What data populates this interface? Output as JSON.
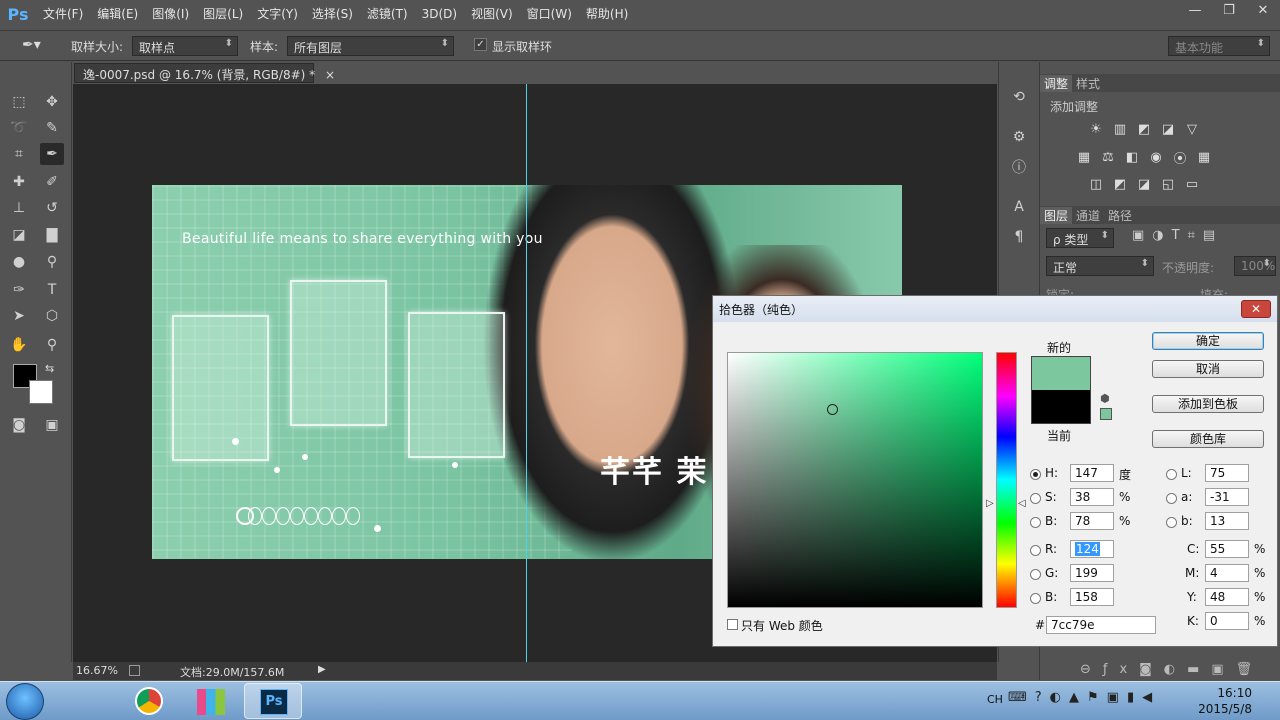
{
  "app": {
    "logo": "Ps"
  },
  "menu": [
    "文件(F)",
    "编辑(E)",
    "图像(I)",
    "图层(L)",
    "文字(Y)",
    "选择(S)",
    "滤镜(T)",
    "3D(D)",
    "视图(V)",
    "窗口(W)",
    "帮助(H)"
  ],
  "window_controls": [
    "—",
    "❐",
    "✕"
  ],
  "options": {
    "sample_size_label": "取样大小:",
    "sample_size_value": "取样点",
    "sample_label": "样本:",
    "sample_value": "所有图层",
    "show_ring_label": "显示取样环",
    "workspace": "基本功能"
  },
  "document": {
    "tab_title": "逸-0007.psd @ 16.7% (背景, RGB/8#) *",
    "tab_close": "×",
    "tagline": "Beautiful life means to share everything with you",
    "logo_text": "芊芊 茉",
    "zoom": "16.67%",
    "doc_size": "文档:29.0M/157.6M"
  },
  "panels": {
    "adjust_tabs": [
      "调整",
      "样式"
    ],
    "adjust_title": "添加调整",
    "layer_tabs": [
      "图层",
      "通道",
      "路径"
    ],
    "filter_label": "ρ 类型",
    "blend_mode": "正常",
    "opacity_label": "不透明度:",
    "opacity_value": "100%",
    "lock_label": "锁定:",
    "fill_label": "填充:"
  },
  "picker": {
    "title": "拾色器（纯色）",
    "close": "✕",
    "new_label": "新的",
    "current_label": "当前",
    "new_color": "#7cc79e",
    "current_color": "#000000",
    "buttons": {
      "ok": "确定",
      "cancel": "取消",
      "add_swatch": "添加到色板",
      "libraries": "颜色库"
    },
    "fields": {
      "H": "147",
      "S": "38",
      "B": "78",
      "R": "124",
      "G": "199",
      "Bv": "158",
      "L": "75",
      "a": "-31",
      "b": "13",
      "C": "55",
      "M": "4",
      "Y": "48",
      "K": "0"
    },
    "labels": {
      "H": "H:",
      "S": "S:",
      "B": "B:",
      "R": "R:",
      "G": "G:",
      "Bv": "B:",
      "L": "L:",
      "a": "a:",
      "b": "b:",
      "C": "C:",
      "M": "M:",
      "Y": "Y:",
      "K": "K:"
    },
    "units": {
      "deg": "度",
      "pct": "%"
    },
    "hex_label": "#",
    "hex": "7cc79e",
    "web_only_label": "只有 Web 颜色"
  },
  "taskbar": {
    "lang": "CH",
    "time": "16:10",
    "date": "2015/5/8",
    "ps_label": "Ps"
  }
}
